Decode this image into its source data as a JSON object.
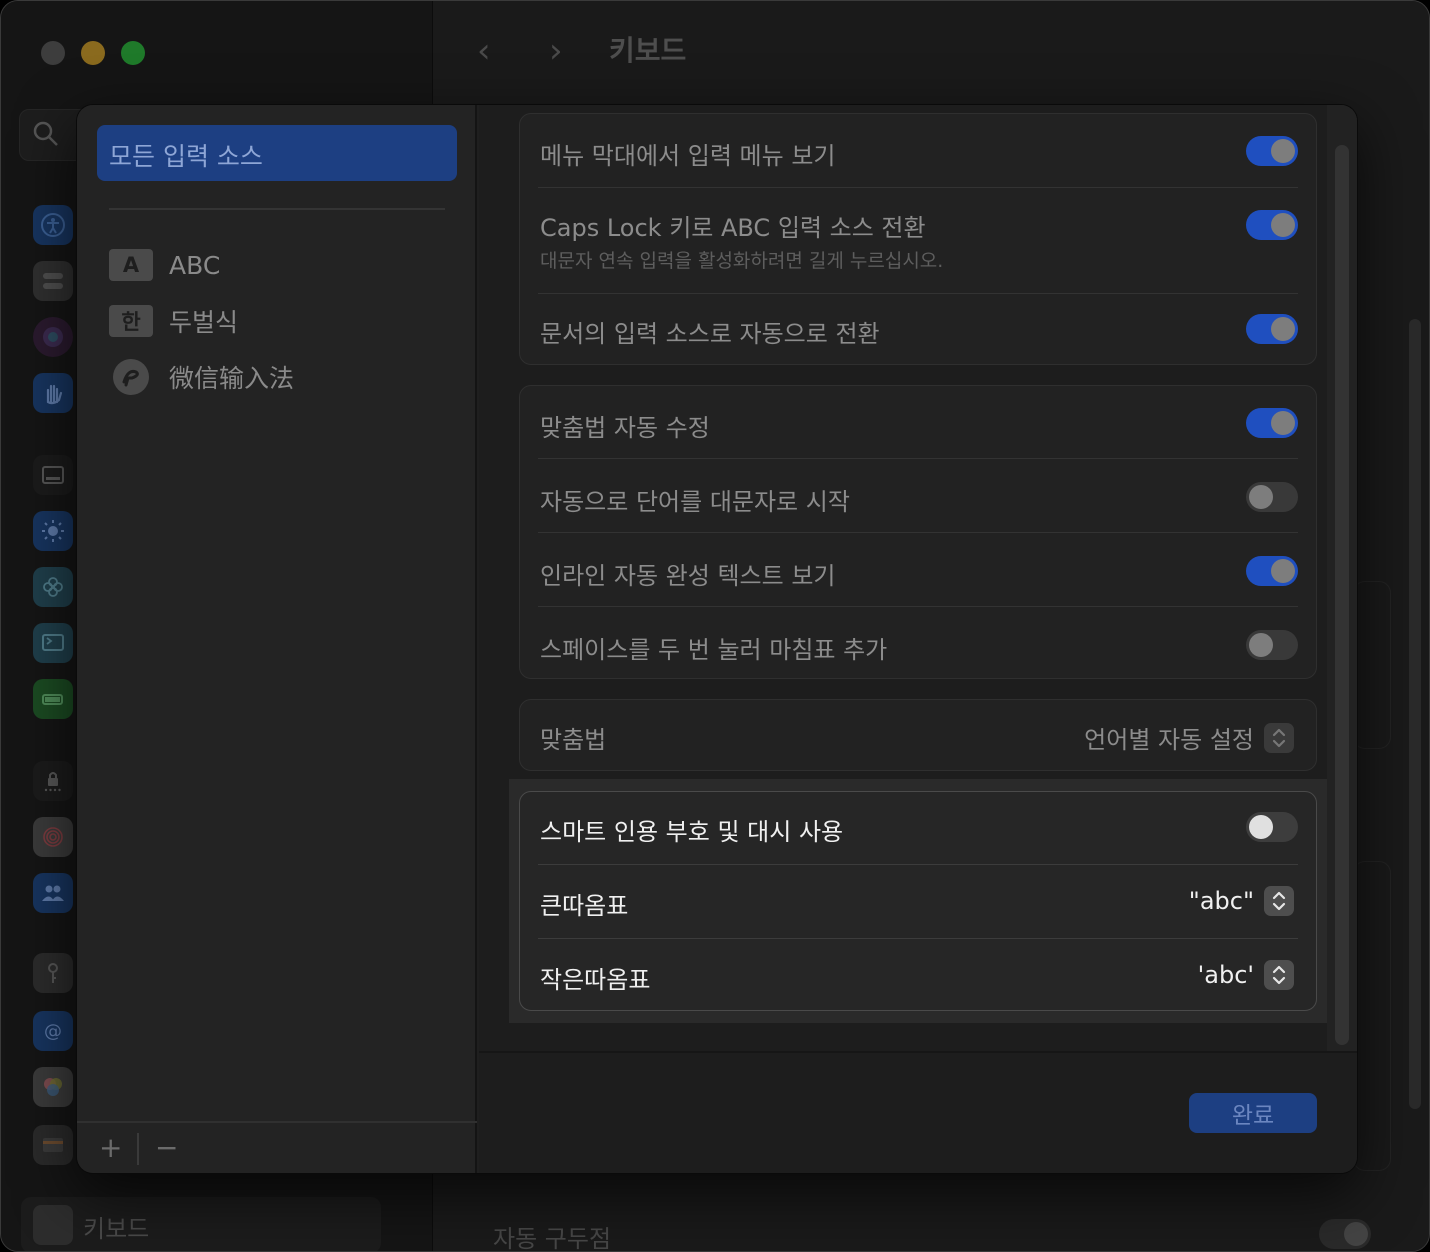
{
  "window": {
    "title": "키보드",
    "sidebar_footer_label": "키보드"
  },
  "background": {
    "bottom_setting_label": "자동 구두점"
  },
  "sheet": {
    "sources_header": "모든 입력 소스",
    "input_sources": [
      {
        "badge": "A",
        "label": "ABC"
      },
      {
        "badge": "한",
        "label": "두벌식"
      },
      {
        "badge": "wechat-icon",
        "label": "微信输入法"
      }
    ],
    "footer": {
      "add_label": "+",
      "remove_label": "−"
    },
    "group1": [
      {
        "label": "메뉴 막대에서 입력 메뉴 보기",
        "on": true
      },
      {
        "label": "Caps Lock 키로 ABC 입력 소스 전환",
        "sublabel": "대문자 연속 입력을 활성화하려면 길게 누르십시오.",
        "on": true
      },
      {
        "label": "문서의 입력 소스로 자동으로 전환",
        "on": true
      }
    ],
    "group2": [
      {
        "label": "맞춤법 자동 수정",
        "on": true
      },
      {
        "label": "자동으로 단어를 대문자로 시작",
        "on": false
      },
      {
        "label": "인라인 자동 완성 텍스트 보기",
        "on": true
      },
      {
        "label": "스페이스를 두 번 눌러 마침표 추가",
        "on": false
      }
    ],
    "spelling": {
      "label": "맞춤법",
      "value": "언어별 자동 설정"
    },
    "smart_quotes": {
      "toggle_label": "스마트 인용 부호 및 대시 사용",
      "toggle_on": false,
      "double_label": "큰따옴표",
      "double_value": "\"abc\"",
      "single_label": "작은따옴표",
      "single_value": "'abc'"
    },
    "done_label": "완료"
  },
  "colors": {
    "accent": "#1f4fbf",
    "selected_bg": "#1d3f82"
  }
}
